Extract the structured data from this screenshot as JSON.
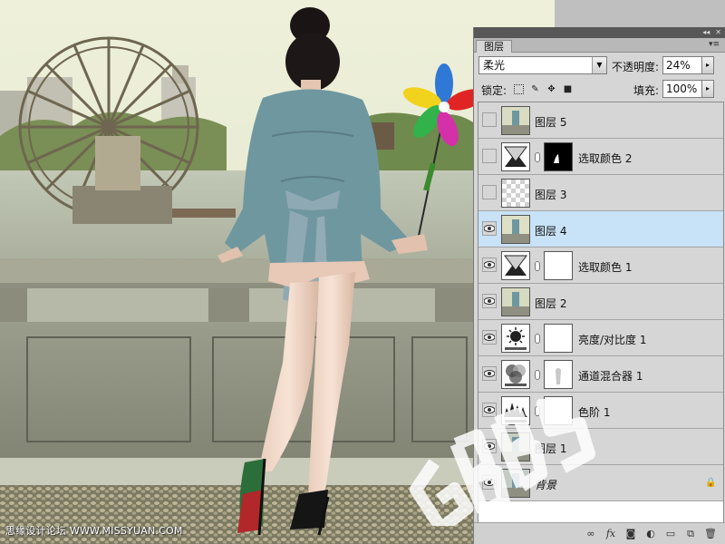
{
  "panel": {
    "tab_label": "图层",
    "menu_glyph": "▾≡",
    "title_buttons": [
      "◂◂",
      "✕"
    ]
  },
  "controls": {
    "blend_mode": "柔光",
    "opacity_label": "不透明度:",
    "opacity_value": "24%",
    "lock_label": "锁定:",
    "fill_label": "填充:",
    "fill_value": "100%"
  },
  "layers": [
    {
      "name": "图层 5",
      "visible": false,
      "selected": false,
      "type": "pixel"
    },
    {
      "name": "选取颜色 2",
      "visible": false,
      "selected": false,
      "type": "selective-color",
      "mask": "black-with-shape"
    },
    {
      "name": "图层 3",
      "visible": false,
      "selected": false,
      "type": "transparent"
    },
    {
      "name": "图层 4",
      "visible": true,
      "selected": true,
      "type": "pixel"
    },
    {
      "name": "选取颜色 1",
      "visible": true,
      "selected": false,
      "type": "selective-color",
      "mask": "white"
    },
    {
      "name": "图层 2",
      "visible": true,
      "selected": false,
      "type": "pixel"
    },
    {
      "name": "亮度/对比度 1",
      "visible": true,
      "selected": false,
      "type": "brightness-contrast",
      "mask": "white"
    },
    {
      "name": "通道混合器 1",
      "visible": true,
      "selected": false,
      "type": "channel-mixer",
      "mask": "white-with-shape"
    },
    {
      "name": "色阶 1",
      "visible": true,
      "selected": false,
      "type": "levels",
      "mask": "white"
    },
    {
      "name": "图层 1",
      "visible": true,
      "selected": false,
      "type": "pixel"
    },
    {
      "name": "背景",
      "visible": true,
      "selected": false,
      "type": "background",
      "locked": true
    }
  ],
  "bottom_toolbar": [
    "link-icon",
    "fx-icon",
    "mask-icon",
    "adjustment-icon",
    "group-icon",
    "new-layer-icon",
    "trash-icon"
  ],
  "watermark": {
    "site_text": "思缘设计论坛 WWW.MISSYUAN.COM",
    "overlay_text": "6BBS"
  },
  "colors": {
    "selected_row": "#c8e2f7",
    "panel_bg": "#d6d6d6",
    "titlebar": "#575757"
  }
}
